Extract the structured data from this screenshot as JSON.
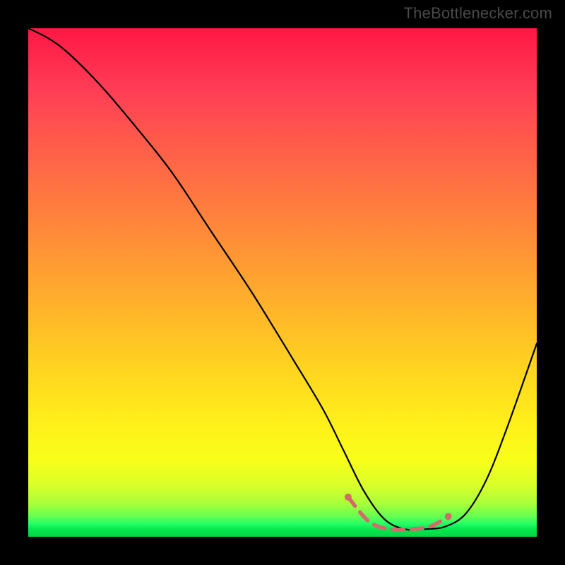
{
  "attribution": "TheBottlenecker.com",
  "chart_data": {
    "type": "line",
    "title": "",
    "xlabel": "",
    "ylabel": "",
    "xlim": [
      0,
      100
    ],
    "ylim": [
      0,
      100
    ],
    "background_gradient": {
      "orientation": "vertical",
      "stops": [
        {
          "pos": 0.0,
          "color": "#ff1744"
        },
        {
          "pos": 0.34,
          "color": "#ff7a3f"
        },
        {
          "pos": 0.68,
          "color": "#ffd71f"
        },
        {
          "pos": 0.9,
          "color": "#d9ff2a"
        },
        {
          "pos": 1.0,
          "color": "#02d646"
        }
      ]
    },
    "series": [
      {
        "name": "bottleneck-curve",
        "stroke": "#000000",
        "stroke_width": 2,
        "x": [
          0,
          4,
          8,
          14,
          20,
          28,
          36,
          44,
          52,
          58,
          62,
          66,
          70,
          74,
          78,
          82,
          86,
          90,
          94,
          100
        ],
        "y": [
          100,
          98,
          95,
          89,
          82,
          72,
          60,
          48,
          35,
          25,
          17,
          9,
          3.5,
          1.5,
          1.5,
          2.0,
          4.5,
          11,
          21,
          38
        ]
      },
      {
        "name": "valley-highlight",
        "stroke": "#d46a6a",
        "stroke_width": 5,
        "dashed": true,
        "dash": [
          14,
          10
        ],
        "x": [
          62.9,
          67,
          71,
          75,
          79,
          82.6
        ],
        "y": [
          7.8,
          3.0,
          1.5,
          1.5,
          2.0,
          4.0
        ]
      }
    ],
    "valley_endpoints": [
      {
        "x": 62.9,
        "y": 7.8
      },
      {
        "x": 82.6,
        "y": 4.0
      }
    ],
    "endpoint_marker": {
      "color": "#d46a6a",
      "radius": 5
    }
  }
}
